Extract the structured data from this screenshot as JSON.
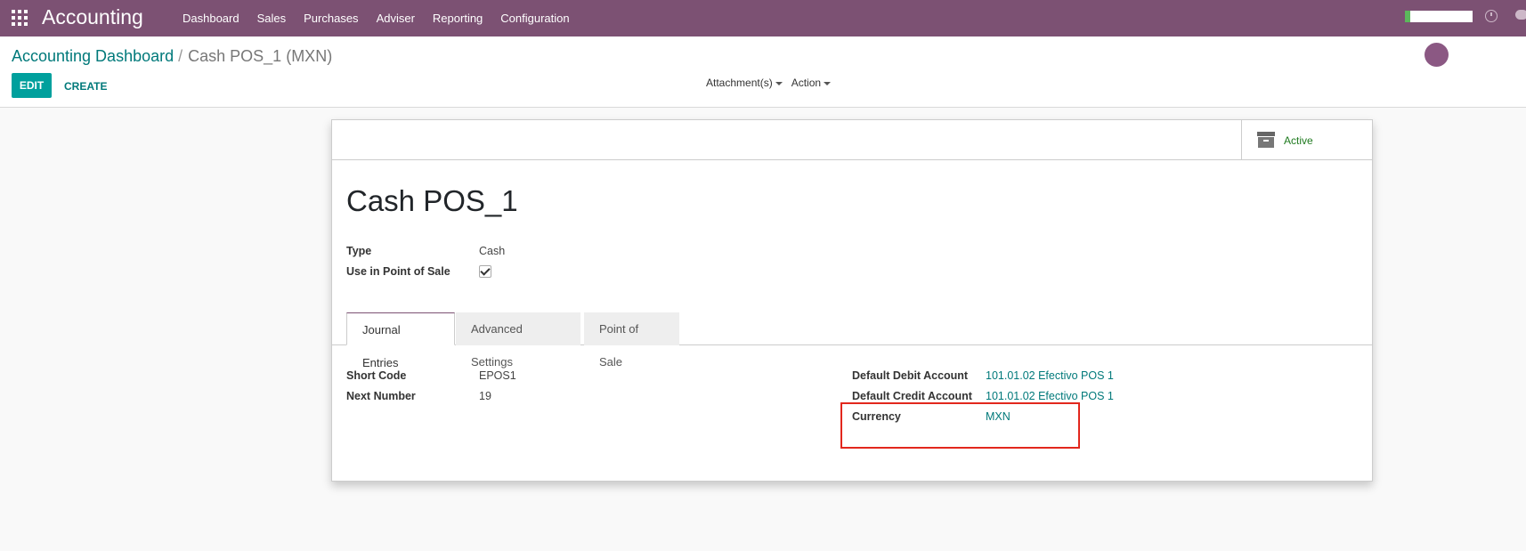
{
  "navbar": {
    "brand": "Accounting",
    "menu": [
      "Dashboard",
      "Sales",
      "Purchases",
      "Adviser",
      "Reporting",
      "Configuration"
    ]
  },
  "control_panel": {
    "breadcrumb_link": "Accounting Dashboard",
    "breadcrumb_separator": "/",
    "breadcrumb_current": "Cash POS_1 (MXN)",
    "edit_label": "EDIT",
    "create_label": "CREATE",
    "attachments_label": "Attachment(s)",
    "action_label": "Action"
  },
  "sheet": {
    "active_label": "Active",
    "title": "Cash POS_1",
    "type_label": "Type",
    "type_value": "Cash",
    "pos_label": "Use in Point of Sale",
    "pos_checked": true,
    "tabs": [
      "Journal Entries",
      "Advanced Settings",
      "Point of Sale"
    ],
    "active_tab": "Journal Entries",
    "short_code_label": "Short Code",
    "short_code_value": "EPOS1",
    "next_number_label": "Next Number",
    "next_number_value": "19",
    "debit_label": "Default Debit Account",
    "debit_value": "101.01.02 Efectivo POS 1",
    "credit_label": "Default Credit Account",
    "credit_value": "101.01.02 Efectivo POS 1",
    "currency_label": "Currency",
    "currency_value": "MXN"
  },
  "colors": {
    "navbar": "#7c5173",
    "primary_button": "#00a09d",
    "link": "#00797a",
    "highlight": "#e2271d"
  }
}
